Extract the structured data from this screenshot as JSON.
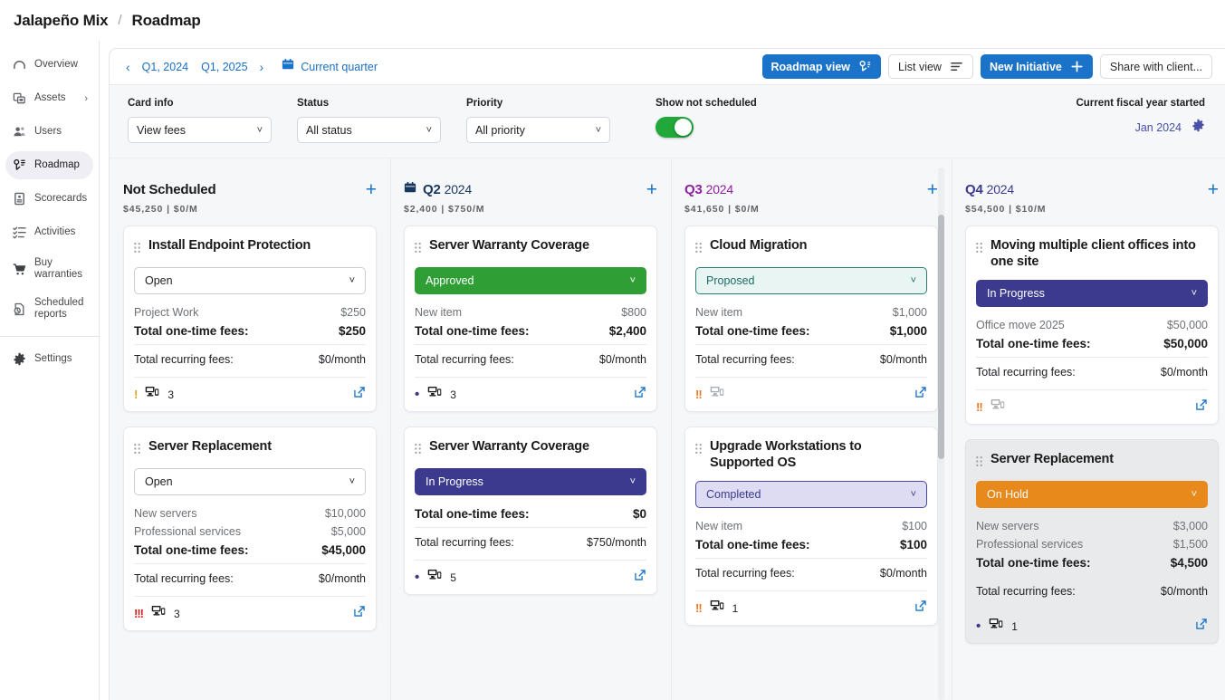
{
  "breadcrumb": {
    "org": "Jalapeño Mix",
    "separator": "/",
    "current": "Roadmap"
  },
  "sidebar": {
    "items": [
      {
        "label": "Overview",
        "icon": "overview-icon",
        "active": false
      },
      {
        "label": "Assets",
        "icon": "assets-icon",
        "active": false,
        "chevron": "›"
      },
      {
        "label": "Users",
        "icon": "users-icon",
        "active": false
      },
      {
        "label": "Roadmap",
        "icon": "roadmap-icon",
        "active": true
      },
      {
        "label": "Scorecards",
        "icon": "scorecards-icon",
        "active": false
      },
      {
        "label": "Activities",
        "icon": "activities-icon",
        "active": false
      },
      {
        "label": "Buy warranties",
        "icon": "cart-icon",
        "active": false
      },
      {
        "label": "Scheduled reports",
        "icon": "scheduled-reports-icon",
        "active": false
      }
    ],
    "settings": {
      "label": "Settings",
      "icon": "gear-icon"
    }
  },
  "quarter_nav": {
    "prev_arrow": "‹",
    "next_arrow": "›",
    "start": "Q1, 2024",
    "end": "Q1, 2025",
    "current_quarter": "Current quarter"
  },
  "toolbar": {
    "roadmap_view": "Roadmap view",
    "list_view": "List view",
    "new_initiative": "New Initiative",
    "new_initiative_plus": "+",
    "share": "Share with client..."
  },
  "filters": {
    "card_info": {
      "label": "Card info",
      "value": "View fees"
    },
    "status": {
      "label": "Status",
      "value": "All status"
    },
    "priority": {
      "label": "Priority",
      "value": "All priority"
    },
    "show_not_scheduled": {
      "label": "Show not scheduled",
      "on": true
    },
    "fiscal": {
      "label": "Current fiscal year started",
      "value": "Jan 2024"
    }
  },
  "labels": {
    "total_one_time": "Total one-time fees:",
    "total_recurring": "Total recurring fees:",
    "add": "+"
  },
  "columns": [
    {
      "id": "not-scheduled",
      "title": "Not Scheduled",
      "year": "",
      "title_color": "#1a1a1a",
      "has_calendar_icon": false,
      "subtotal": "$45,250 | $0/M",
      "cards": [
        {
          "title": "Install Endpoint Protection",
          "status": "Open",
          "status_class": "st-open",
          "line_items": [
            {
              "name": "Project Work",
              "amount": "$250"
            }
          ],
          "one_time": "$250",
          "recurring": "$0/month",
          "priority": "!",
          "priority_class": "p1",
          "count": "3",
          "shaded": false
        },
        {
          "title": "Server Replacement",
          "status": "Open",
          "status_class": "st-open",
          "line_items": [
            {
              "name": "New servers",
              "amount": "$10,000"
            },
            {
              "name": "Professional services",
              "amount": "$5,000"
            }
          ],
          "one_time": "$45,000",
          "recurring": "$0/month",
          "priority": "!!!",
          "priority_class": "p3",
          "count": "3",
          "shaded": false
        }
      ]
    },
    {
      "id": "q2-2024",
      "title": "Q2",
      "year": "2024",
      "title_color": "#17375e",
      "has_calendar_icon": true,
      "subtotal": "$2,400 | $750/M",
      "cards": [
        {
          "title": "Server Warranty Coverage",
          "status": "Approved",
          "status_class": "st-approved",
          "line_items": [
            {
              "name": "New item",
              "amount": "$800"
            }
          ],
          "one_time": "$2,400",
          "recurring": "$0/month",
          "priority": "•",
          "priority_class": "p0",
          "count": "3",
          "shaded": false
        },
        {
          "title": "Server Warranty Coverage",
          "status": "In Progress",
          "status_class": "st-progress",
          "line_items": [],
          "one_time": "$0",
          "recurring": "$750/month",
          "priority": "•",
          "priority_class": "p0",
          "count": "5",
          "shaded": false
        }
      ]
    },
    {
      "id": "q3-2024",
      "title": "Q3",
      "year": "2024",
      "title_color": "#8e1fa0",
      "has_calendar_icon": false,
      "subtotal": "$41,650 | $0/M",
      "cards": [
        {
          "title": "Cloud Migration",
          "status": "Proposed",
          "status_class": "st-proposed",
          "line_items": [
            {
              "name": "New item",
              "amount": "$1,000"
            }
          ],
          "one_time": "$1,000",
          "recurring": "$0/month",
          "priority": "!!",
          "priority_class": "p2",
          "count": "",
          "shaded": false
        },
        {
          "title": "Upgrade Workstations to Supported OS",
          "status": "Completed",
          "status_class": "st-completed",
          "line_items": [
            {
              "name": "New item",
              "amount": "$100"
            }
          ],
          "one_time": "$100",
          "recurring": "$0/month",
          "priority": "!!",
          "priority_class": "p2",
          "count": "1",
          "shaded": false
        }
      ]
    },
    {
      "id": "q4-2024",
      "title": "Q4",
      "year": "2024",
      "title_color": "#3b3a8f",
      "has_calendar_icon": false,
      "subtotal": "$54,500 | $10/M",
      "cards": [
        {
          "title": "Moving multiple client offices into one site",
          "status": "In Progress",
          "status_class": "st-progress",
          "line_items": [
            {
              "name": "Office move 2025",
              "amount": "$50,000"
            }
          ],
          "one_time": "$50,000",
          "recurring": "$0/month",
          "priority": "!!",
          "priority_class": "p2",
          "count": "",
          "shaded": false
        },
        {
          "title": "Server Replacement",
          "status": "On Hold",
          "status_class": "st-onhold",
          "line_items": [
            {
              "name": "New servers",
              "amount": "$3,000"
            },
            {
              "name": "Professional services",
              "amount": "$1,500"
            }
          ],
          "one_time": "$4,500",
          "recurring": "$0/month",
          "priority": "•",
          "priority_class": "p0",
          "count": "1",
          "shaded": true
        }
      ]
    }
  ]
}
